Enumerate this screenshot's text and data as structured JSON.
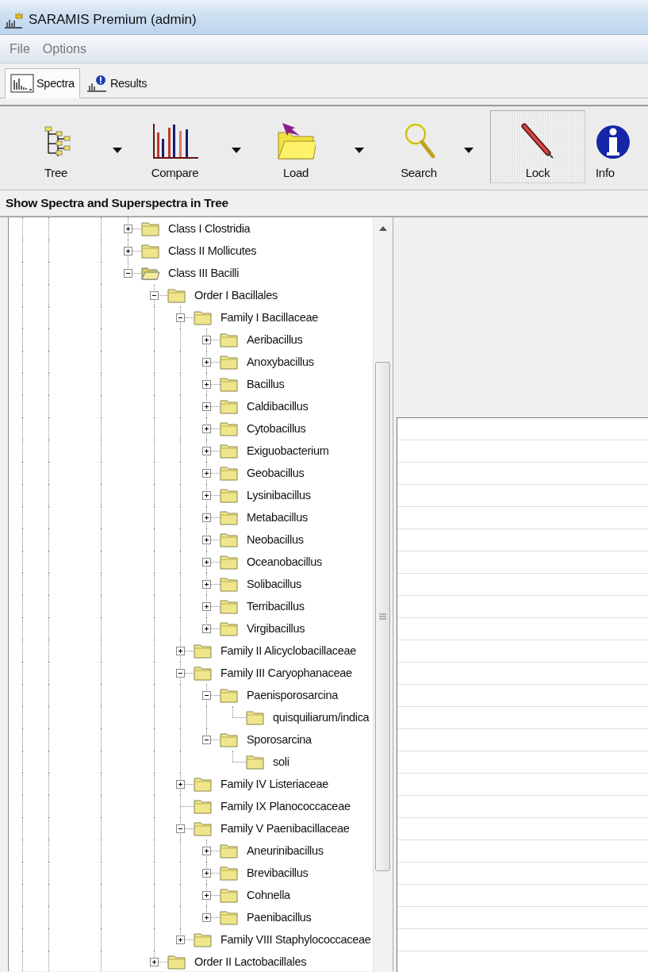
{
  "window": {
    "title": "SARAMIS Premium (admin)"
  },
  "menu": [
    "File",
    "Options"
  ],
  "tabs": [
    {
      "label": "Spectra",
      "selected": true
    },
    {
      "label": "Results",
      "selected": false
    }
  ],
  "toolbar": [
    {
      "label": "Tree",
      "kind": "dropdown",
      "checked": false
    },
    {
      "label": "Compare",
      "kind": "dropdown",
      "checked": false
    },
    {
      "label": "Load",
      "kind": "dropdown",
      "checked": false
    },
    {
      "label": "Search",
      "kind": "dropdown",
      "checked": false
    },
    {
      "label": "Lock",
      "kind": "toggle",
      "checked": true
    },
    {
      "label": "Info",
      "kind": "plain",
      "checked": false
    }
  ],
  "panel_header": "Show Spectra and Superspectra in Tree",
  "tree": [
    {
      "label": "Class I Clostridia",
      "expanded": false,
      "selected": false
    },
    {
      "label": "Class II Mollicutes",
      "expanded": false,
      "selected": false
    },
    {
      "label": "Class III Bacilli",
      "expanded": true,
      "selected": true,
      "children": [
        {
          "label": "Order I Bacillales",
          "expanded": true,
          "selected": false,
          "children": [
            {
              "label": "Family I Bacillaceae",
              "expanded": true,
              "selected": false,
              "children": [
                {
                  "label": "Aeribacillus",
                  "expanded": false,
                  "selected": false
                },
                {
                  "label": "Anoxybacillus",
                  "expanded": false,
                  "selected": false
                },
                {
                  "label": "Bacillus",
                  "expanded": false,
                  "selected": false
                },
                {
                  "label": "Caldibacillus",
                  "expanded": false,
                  "selected": false
                },
                {
                  "label": "Cytobacillus",
                  "expanded": false,
                  "selected": false
                },
                {
                  "label": "Exiguobacterium",
                  "expanded": false,
                  "selected": false
                },
                {
                  "label": "Geobacillus",
                  "expanded": false,
                  "selected": false
                },
                {
                  "label": "Lysinibacillus",
                  "expanded": false,
                  "selected": false
                },
                {
                  "label": "Metabacillus",
                  "expanded": false,
                  "selected": false
                },
                {
                  "label": "Neobacillus",
                  "expanded": false,
                  "selected": false
                },
                {
                  "label": "Oceanobacillus",
                  "expanded": false,
                  "selected": false
                },
                {
                  "label": "Solibacillus",
                  "expanded": false,
                  "selected": false
                },
                {
                  "label": "Terribacillus",
                  "expanded": false,
                  "selected": false
                },
                {
                  "label": "Virgibacillus",
                  "expanded": false,
                  "selected": false
                }
              ]
            },
            {
              "label": "Family II Alicyclobacillaceae",
              "expanded": false,
              "selected": false
            },
            {
              "label": "Family III Caryophanaceae",
              "expanded": true,
              "selected": false,
              "children": [
                {
                  "label": "Paenisporosarcina",
                  "expanded": true,
                  "selected": false,
                  "children": [
                    {
                      "label": "quisquiliarum/indica",
                      "selected": false
                    }
                  ]
                },
                {
                  "label": "Sporosarcina",
                  "expanded": true,
                  "selected": false,
                  "children": [
                    {
                      "label": "soli",
                      "selected": false
                    }
                  ]
                }
              ]
            },
            {
              "label": "Family IV Listeriaceae",
              "expanded": false,
              "selected": false
            },
            {
              "label": "Family IX Planococcaceae",
              "selected": false
            },
            {
              "label": "Family V Paenibacillaceae",
              "expanded": true,
              "selected": false,
              "children": [
                {
                  "label": "Aneurinibacillus",
                  "expanded": false,
                  "selected": false
                },
                {
                  "label": "Brevibacillus",
                  "expanded": false,
                  "selected": false
                },
                {
                  "label": "Cohnella",
                  "expanded": false,
                  "selected": false
                },
                {
                  "label": "Paenibacillus",
                  "expanded": false,
                  "selected": false
                }
              ]
            },
            {
              "label": "Family VIII Staphylococcaceae",
              "expanded": false,
              "selected": false
            }
          ]
        },
        {
          "label": "Order II Lactobacillales",
          "expanded": false,
          "selected": false
        }
      ]
    }
  ]
}
